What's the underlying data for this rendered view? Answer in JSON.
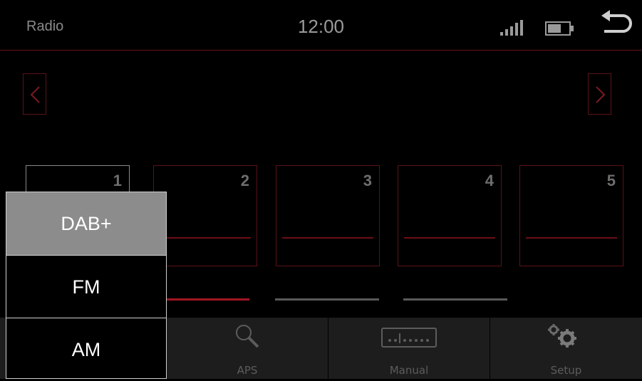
{
  "header": {
    "title": "Radio",
    "clock": "12:00",
    "icons": [
      "signal-strength-icon",
      "battery-icon",
      "back-icon"
    ]
  },
  "navigation": {
    "prev_icon": "chevron-left-icon",
    "next_icon": "chevron-right-icon"
  },
  "presets": [
    {
      "number": "1",
      "selected": true
    },
    {
      "number": "2",
      "selected": false
    },
    {
      "number": "3",
      "selected": false
    },
    {
      "number": "4",
      "selected": false
    },
    {
      "number": "5",
      "selected": false
    }
  ],
  "page_indicator": {
    "pages": 3,
    "current": 1,
    "active_color": "#a01622",
    "inactive_color": "#5a5a5a"
  },
  "bottom_bar": {
    "aps_label": "APS",
    "manual_label": "Manual",
    "setup_label": "Setup"
  },
  "band_menu": {
    "items": [
      "DAB+",
      "FM",
      "AM"
    ],
    "selected": "DAB+"
  },
  "colors": {
    "accent": "#a01622",
    "background": "#000000",
    "bar": "#1d1d1d",
    "selected_band": "#8c8c8c"
  }
}
